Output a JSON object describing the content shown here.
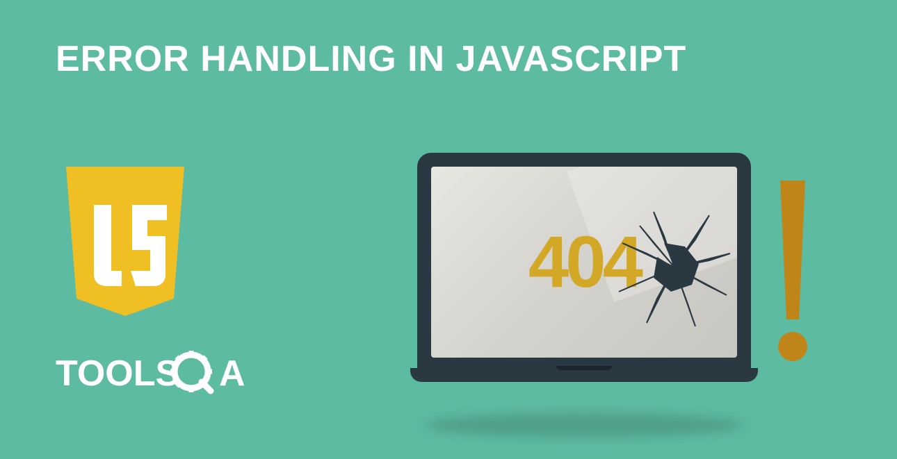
{
  "title": "ERROR HANDLING IN JAVASCRIPT",
  "js_logo_text": "JS",
  "tools_logo_text": "TOOLS",
  "qa_logo_letter_q": "Q",
  "qa_logo_letter_a": "A",
  "error_code": "404",
  "colors": {
    "background": "#5dbba2",
    "js_shield": "#f0bf24",
    "js_text": "#ffffff",
    "error_code": "#d4a827",
    "exclamation": "#c08518",
    "laptop_frame": "#2a3842",
    "laptop_screen": "#e8e6e1"
  }
}
